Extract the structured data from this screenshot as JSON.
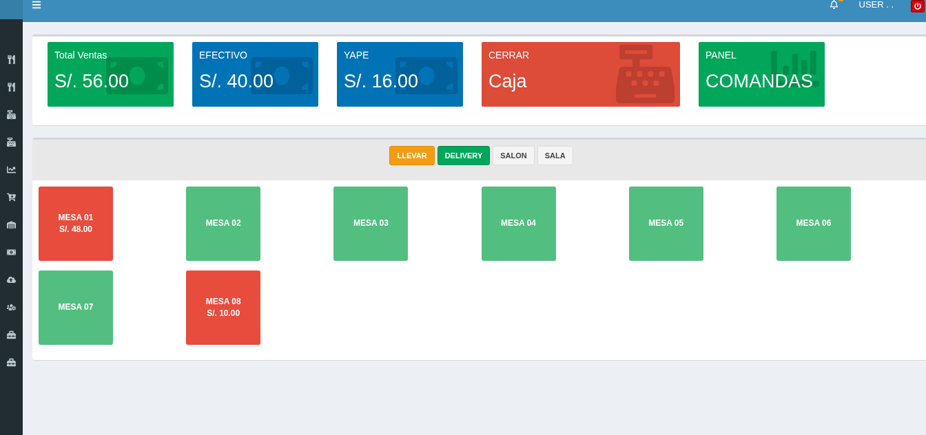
{
  "header": {
    "user": "USER . ."
  },
  "stats": [
    {
      "kind": "money",
      "color": "#00a65a",
      "label": "Total Ventas",
      "value": "S/. 56.00"
    },
    {
      "kind": "money",
      "color": "#0073b7",
      "label": "EFECTIVO",
      "value": "S/. 40.00"
    },
    {
      "kind": "money",
      "color": "#0073b7",
      "label": "YAPE",
      "value": "S/. 16.00"
    },
    {
      "kind": "register",
      "color": "#dd4b39",
      "label": "CERRAR",
      "value": "Caja"
    },
    {
      "kind": "chart",
      "color": "#00a65a",
      "label": "PANEL",
      "value": "COMANDAS"
    }
  ],
  "filters": [
    {
      "label": "LLEVAR",
      "kind": "warning"
    },
    {
      "label": "DELIVERY",
      "kind": "success"
    },
    {
      "label": "SALON",
      "kind": "default"
    },
    {
      "label": "SALA",
      "kind": "default"
    }
  ],
  "tables": [
    {
      "name": "MESA 01",
      "occupied": true,
      "total": "S/. 48.00"
    },
    {
      "name": "MESA 02",
      "occupied": false
    },
    {
      "name": "MESA 03",
      "occupied": false
    },
    {
      "name": "MESA 04",
      "occupied": false
    },
    {
      "name": "MESA 05",
      "occupied": false
    },
    {
      "name": "MESA 06",
      "occupied": false
    },
    {
      "name": "MESA 07",
      "occupied": false
    },
    {
      "name": "MESA 08",
      "occupied": true,
      "total": "S/. 10.00"
    }
  ]
}
